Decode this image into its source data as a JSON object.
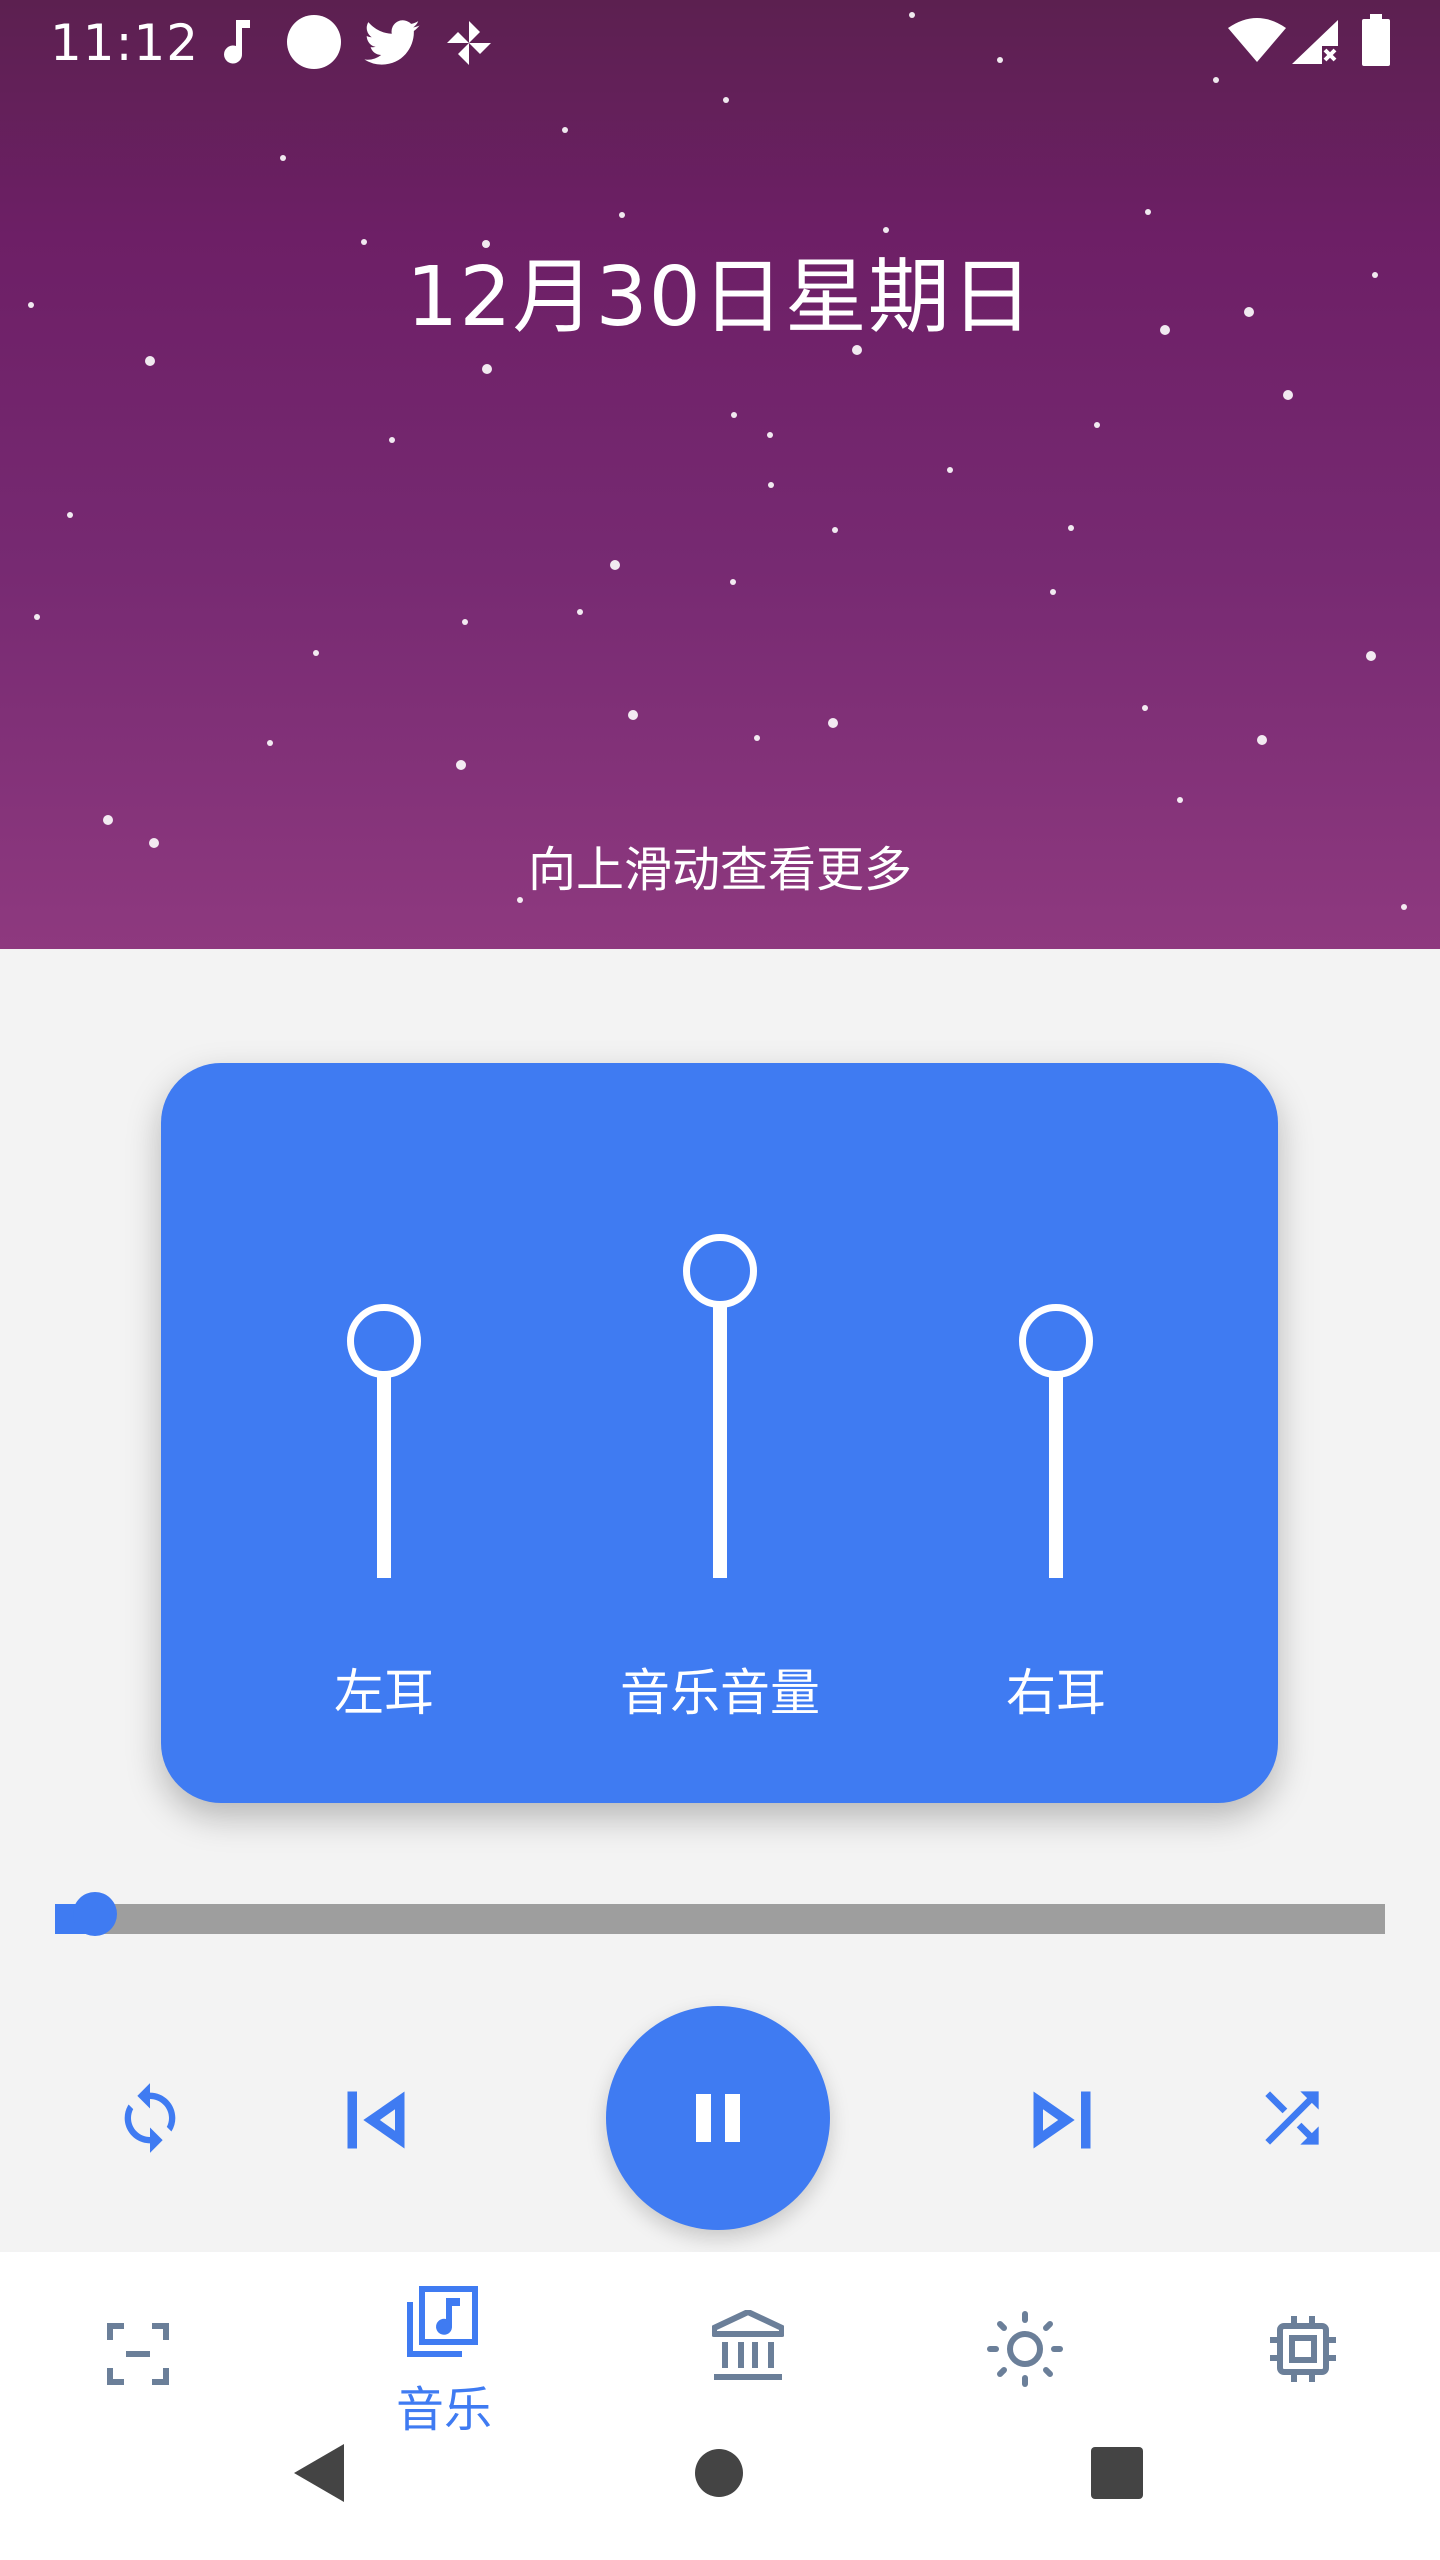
{
  "status_bar": {
    "time": "11:12",
    "left_icons": [
      "music-note-icon",
      "circle-icon",
      "twitter-icon",
      "pinwheel-icon"
    ],
    "right_icons": [
      "wifi-icon",
      "cellular-no-signal-icon",
      "battery-icon"
    ]
  },
  "header": {
    "date": "12月30日星期日",
    "swipe_hint": "向上滑动查看更多"
  },
  "equalizer": {
    "sliders": [
      {
        "label": "左耳",
        "level": 0.9
      },
      {
        "label": "音乐音量",
        "level": 1.0
      },
      {
        "label": "右耳",
        "level": 0.9
      }
    ]
  },
  "playback": {
    "progress": 0.03
  },
  "controls": {
    "buttons": [
      "repeat-icon",
      "skip-previous-icon",
      "pause-icon",
      "skip-next-icon",
      "shuffle-icon"
    ]
  },
  "bottom_nav": {
    "items": [
      {
        "icon": "crop-free-icon",
        "label": ""
      },
      {
        "icon": "music-library-icon",
        "label": "音乐",
        "active": true
      },
      {
        "icon": "bank-icon",
        "label": ""
      },
      {
        "icon": "brightness-icon",
        "label": ""
      },
      {
        "icon": "chip-icon",
        "label": ""
      }
    ]
  },
  "colors": {
    "accent": "#3f7bf2",
    "header_top": "#5c2050",
    "header_bottom": "#8e397f",
    "inactive_icon": "#6b7f99"
  }
}
